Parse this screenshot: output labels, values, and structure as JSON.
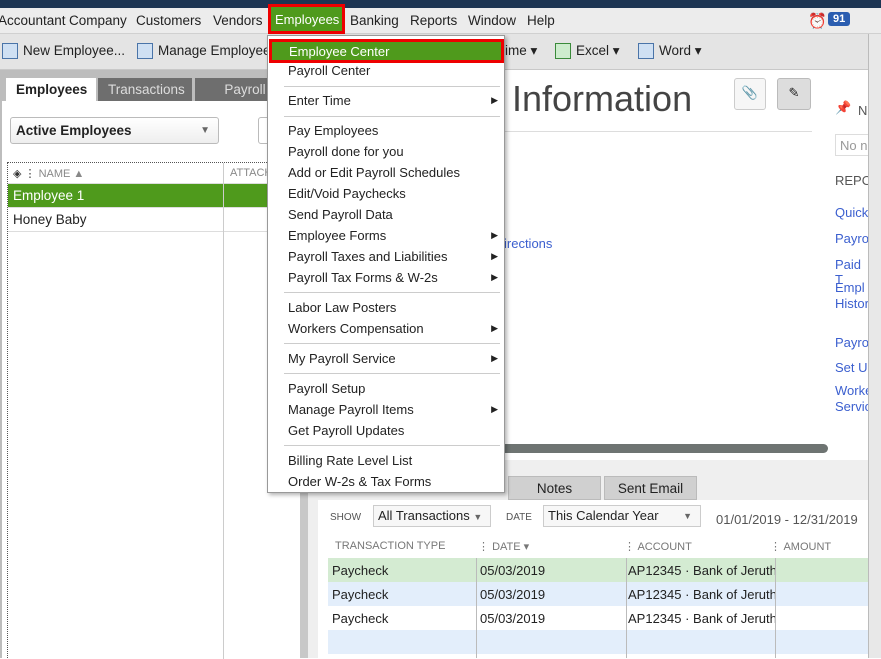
{
  "menubar": {
    "items": [
      "Accountant",
      "Company",
      "Customers",
      "Vendors",
      "Employees",
      "Banking",
      "Reports",
      "Window",
      "Help"
    ],
    "alarm_count": "91"
  },
  "toolbar": {
    "new_employee": "New Employee...",
    "manage_employee": "Manage Employee",
    "time": "ime",
    "excel": "Excel",
    "word": "Word"
  },
  "left": {
    "tabs": [
      "Employees",
      "Transactions",
      "Payroll"
    ],
    "filter": "Active Employees",
    "col_name": "NAME",
    "col_attach": "ATTACH",
    "employees": [
      "Employee 1",
      "Honey Baby"
    ]
  },
  "dropdown": {
    "items": [
      {
        "label": "Employee Center"
      },
      {
        "label": "Payroll Center"
      },
      {
        "label": "Enter Time",
        "sub": true
      },
      {
        "label": "Pay Employees"
      },
      {
        "label": "Payroll done for you"
      },
      {
        "label": "Add or Edit Payroll Schedules"
      },
      {
        "label": "Edit/Void Paychecks"
      },
      {
        "label": "Send Payroll Data"
      },
      {
        "label": "Employee Forms",
        "sub": true
      },
      {
        "label": "Payroll Taxes and Liabilities",
        "sub": true
      },
      {
        "label": "Payroll Tax Forms & W-2s",
        "sub": true
      },
      {
        "label": "Labor Law Posters"
      },
      {
        "label": "Workers Compensation",
        "sub": true
      },
      {
        "label": "My Payroll Service",
        "sub": true
      },
      {
        "label": "Payroll Setup"
      },
      {
        "label": "Manage Payroll Items",
        "sub": true
      },
      {
        "label": "Get Payroll Updates"
      },
      {
        "label": "Billing Rate Level List"
      },
      {
        "label": "Order W-2s & Tax Forms"
      }
    ]
  },
  "content": {
    "title": "Information",
    "directions": "irections",
    "notes_label": "N",
    "notes_placeholder": "No n",
    "reports_header": "REPO",
    "report_links": [
      "Quick",
      "Payro",
      "Paid T",
      "Empl",
      "Histor",
      "Payro",
      "Set U",
      "Worke",
      "Servic"
    ]
  },
  "bottom": {
    "tabs": [
      "Notes",
      "Sent Email"
    ],
    "show_label": "SHOW",
    "show_value": "All Transactions",
    "date_label": "DATE",
    "date_value": "This Calendar Year",
    "date_range": "01/01/2019 - 12/31/2019",
    "columns": [
      "TRANSACTION TYPE",
      "DATE",
      "ACCOUNT",
      "AMOUNT"
    ],
    "rows": [
      [
        "Paycheck",
        "05/03/2019",
        "AP12345 · Bank of Jeruth",
        ""
      ],
      [
        "Paycheck",
        "05/03/2019",
        "AP12345 · Bank of Jeruth",
        ""
      ],
      [
        "Paycheck",
        "05/03/2019",
        "AP12345 · Bank of Jeruth",
        ""
      ]
    ]
  },
  "colors": {
    "accent_green": "#4f9a1c",
    "highlight_red": "#e00000",
    "link_blue": "#3b5fcf"
  }
}
